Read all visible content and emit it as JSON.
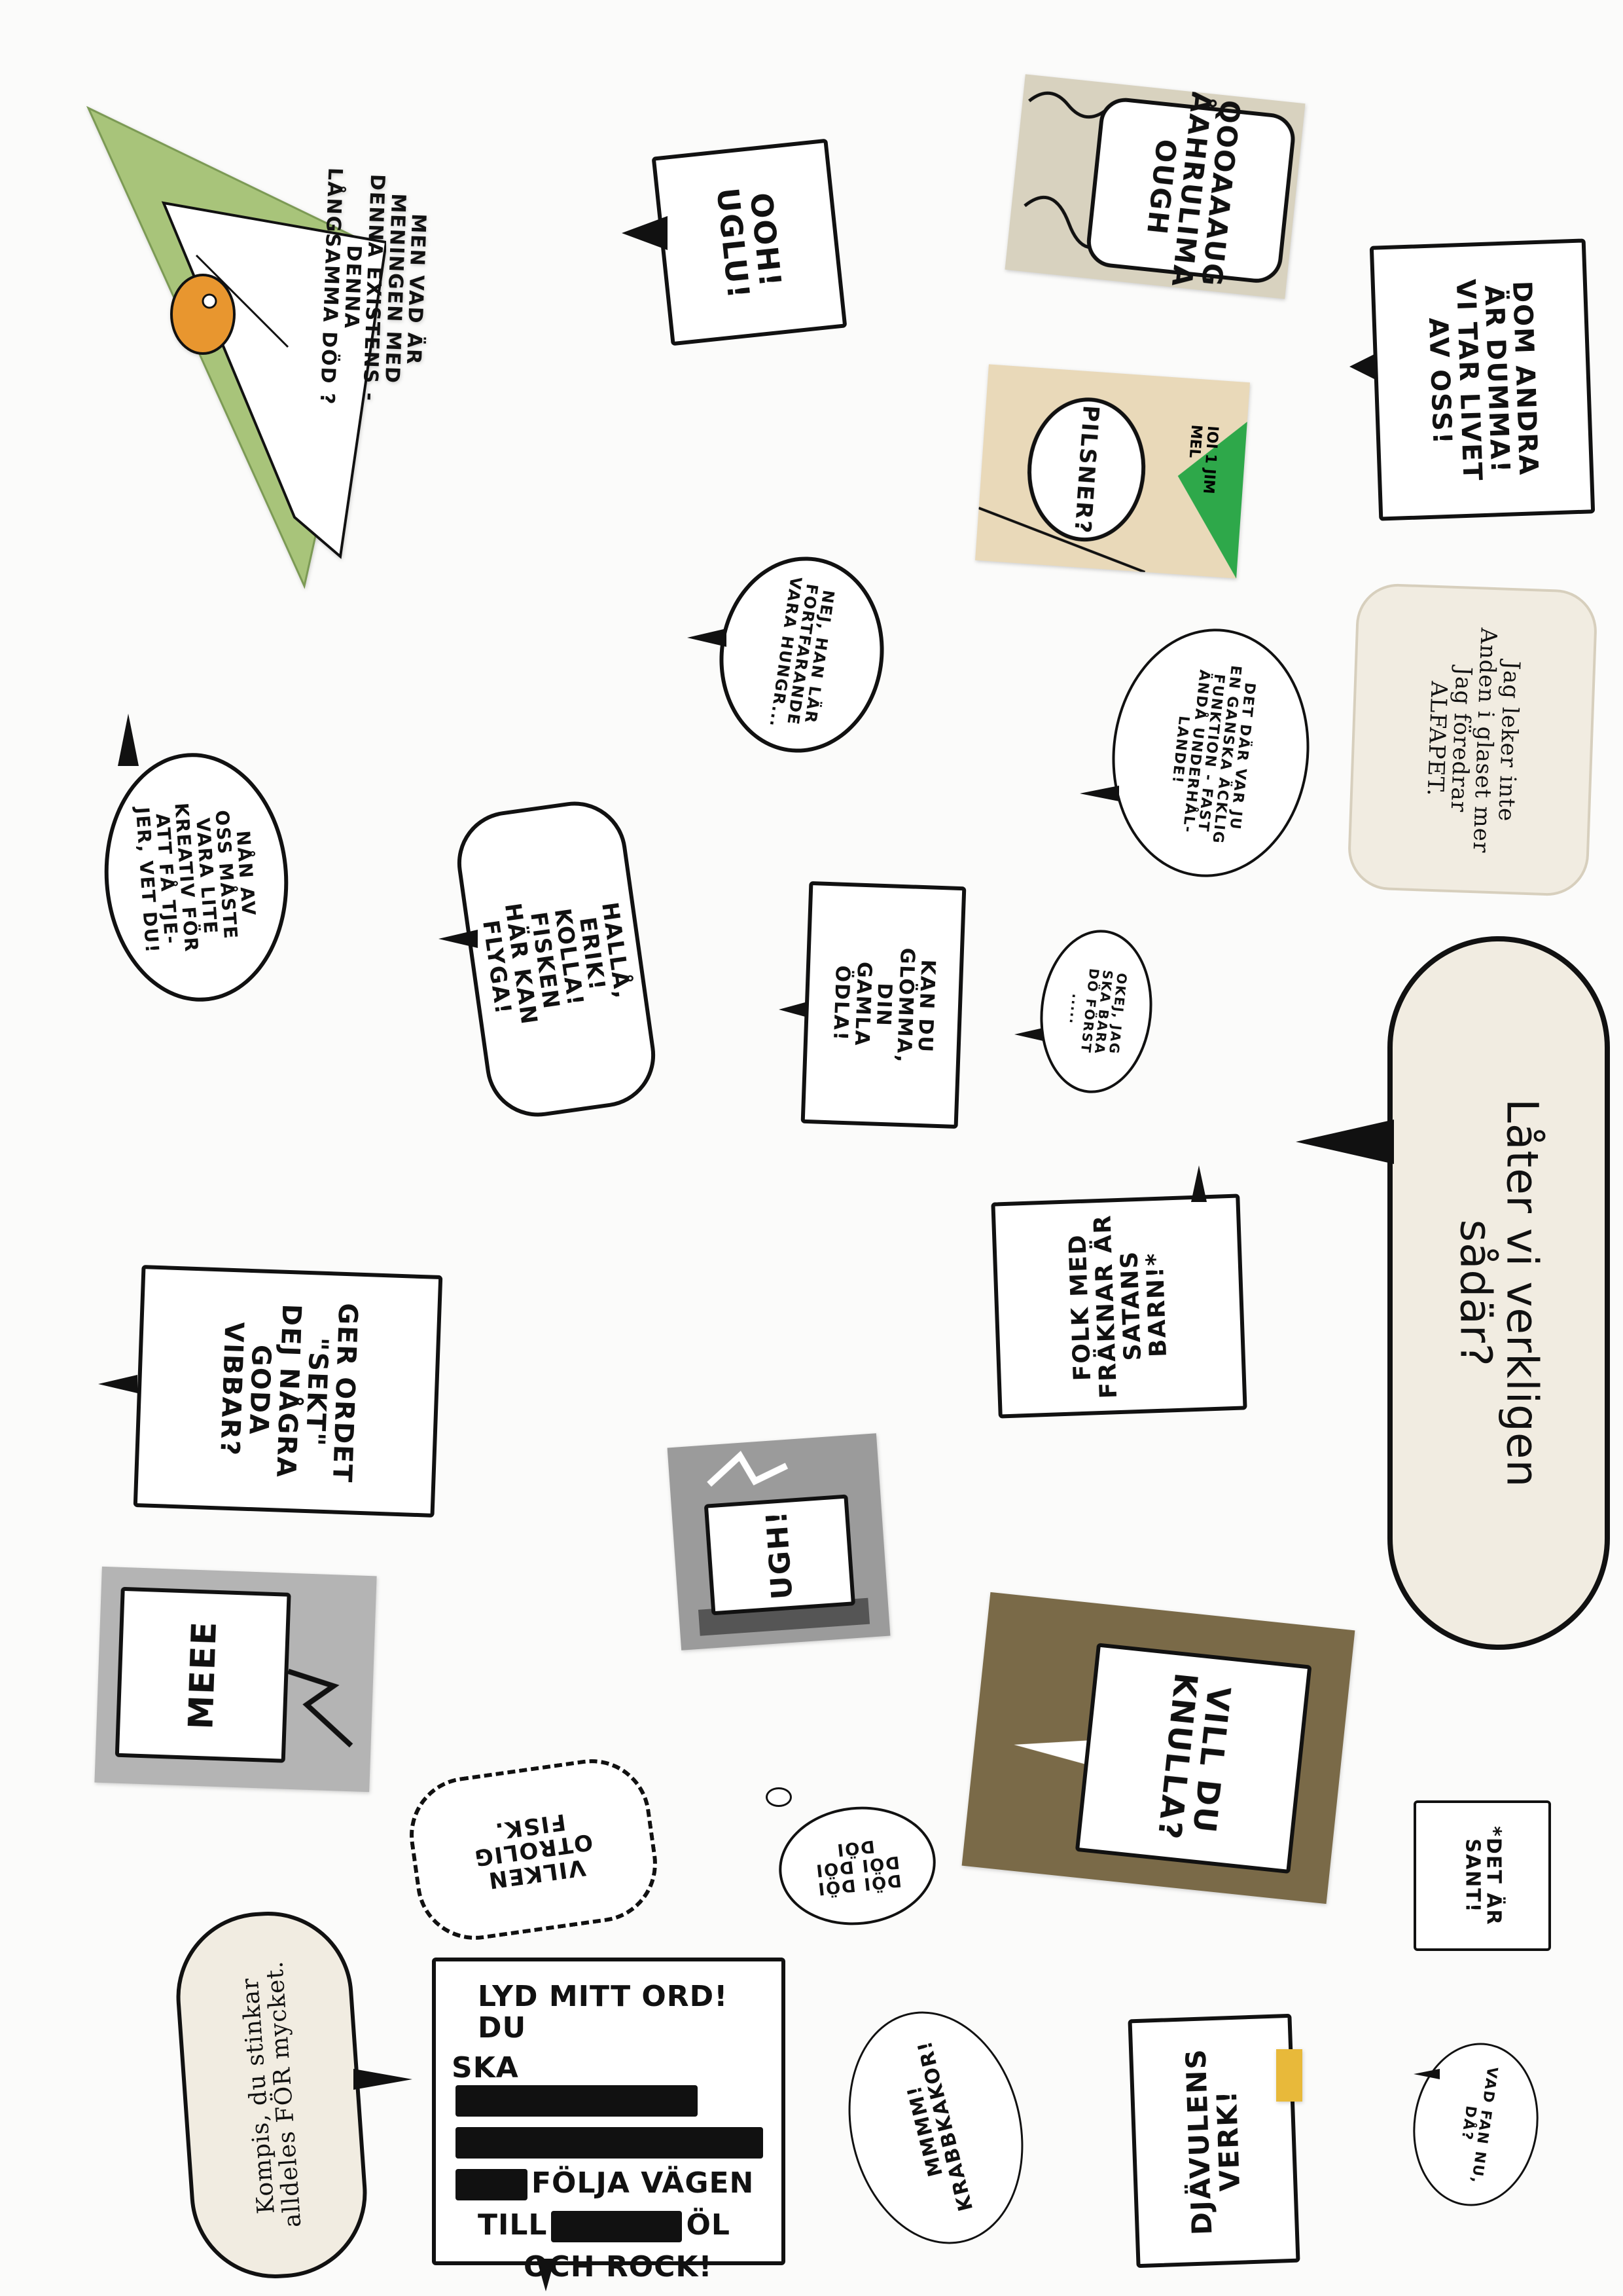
{
  "bubbles": {
    "meningen": "MEN VAD ÄR MENINGEN MED\nDENNA EXISTENS - DENNA\nLÅNGSAMMA DÖD ?",
    "ooh_uglu": "OOH!\nUGLU!",
    "aahrulimah": "QOOAAAUG\nÅÅAHRULIMAH\nOUGH",
    "dom_andra": "DOM ANDRA\nÄR DUMMA!\nVI TAR LIVET\nAV OSS!",
    "pilsner": "PILSNER?",
    "jim_mel": "IOI 1 JIM MEL",
    "nej_han": "NEJ, HAN LÄR\nFORTFARANDE\nVARA HUNGR...",
    "jag_leker": "Jag leker inte\nAnden i glaset mer\nJag föredrar\nALFAPET.",
    "det_dar": "DET DÄR VAR JU\nEN GANSKA ÄCKLIG\nFUNKTION - FAST\nÄNDÅ UNDERHÅL-\nLANDE!",
    "nan_av_oss": "NÅN AV\nOSS MÅSTE\nVARA LITE\nKREATIV FÖR\nATT FÅ TJE-\nJER, VET DU!",
    "halla_erik": "HALLÅ, ERIK!\nKOLLA! FISKEN\nHÄR KAN FLYGA!",
    "kan_du": "KAN DU\nGLÖMMA, DIN\nGAMLA ÖDLA!",
    "okej_jag": "OKEJ, JAG\nSKA BARA\nDÖ FÖRST\n.....",
    "later_vi": "Låter vi verkligen\nsådär?",
    "folk_med": "FOLK MED\nFRÄKNAR ÄR\nSATANS\nBARN!*",
    "ger_ordet": "GER ORDET\n\"SEKT\"\nDEJ NÅGRA\nGODA\nVIBBAR?",
    "ugh": "UGH!",
    "meeeh": "MEEE",
    "vill_du": "VILL DU\nKNULLA?",
    "vilken_fisk": "VILKEN\nOTROLIG\nFISK.",
    "doi_doi": "DÖI DÖI\nDÖI DÖI\nDÖI",
    "det_ar_sant": "*DET ÄR\nSANT!",
    "kompis": "Kompis, du stinkar\nalldeles FÖR mycket.",
    "lyd_line1": "LYD MITT ORD! DU",
    "lyd_line2": "SKA",
    "lyd_line4": "FÖLJA VÄGEN",
    "lyd_line5a": "TILL",
    "lyd_line5b": "ÖL",
    "lyd_line6": "OCH ROCK!",
    "mmmm": "MMMM!\nKRABBKAKOR!",
    "djavulens": "DJÄVULENS\nVERK!",
    "vad_fan": "VAD FAN NU,\nDÅ?"
  },
  "colors": {
    "ink": "#111111",
    "paper": "#ffffff",
    "cream": "#f1ece1",
    "green_panel": "#a8c47a",
    "olive_panel": "#7a6a48",
    "grey_panel": "#a9a9a9"
  }
}
